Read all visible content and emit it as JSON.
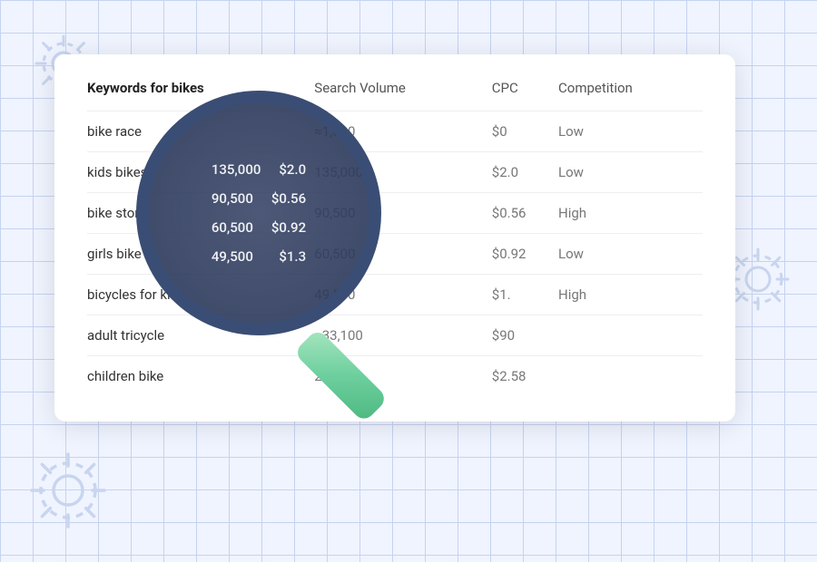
{
  "background": {
    "gridColor": "#c5d3f0",
    "bgColor": "#f0f4ff"
  },
  "card": {
    "title_prefix": "Keywords for ",
    "title_keyword": "bikes",
    "columns": [
      "Search Volume",
      "CPC",
      "Competition"
    ],
    "rows": [
      {
        "keyword": "bike race",
        "volume": "≈1,000",
        "cpc": "$0",
        "competition": "Low"
      },
      {
        "keyword": "kids bikes",
        "volume": "135,000",
        "cpc": "$2.0",
        "competition": "Low"
      },
      {
        "keyword": "bike store",
        "volume": "90,500",
        "cpc": "$0.56",
        "competition": "High"
      },
      {
        "keyword": "girls bike",
        "volume": "60,500",
        "cpc": "$0.92",
        "competition": "Low"
      },
      {
        "keyword": "bicycles for kids",
        "volume": "49,500",
        "cpc": "$1.",
        "competition": "High"
      },
      {
        "keyword": "adult tricycle",
        "volume": "≈33,100",
        "cpc": "$90",
        "competition": ""
      },
      {
        "keyword": "children bike",
        "volume": "27,100",
        "cpc": "$2.58",
        "competition": ""
      }
    ]
  },
  "magnifier": {
    "lens_rows": [
      {
        "volume": "135,000",
        "cpc": "$2.0"
      },
      {
        "volume": "90,500",
        "cpc": "$0.56"
      },
      {
        "volume": "60,500",
        "cpc": "$0.92"
      },
      {
        "volume": "49,500",
        "cpc": "$1.3"
      }
    ]
  },
  "gears": {
    "topLeft": "gear-top-left-icon",
    "bottomLeft": "gear-bottom-left-icon",
    "right": "gear-right-icon"
  }
}
